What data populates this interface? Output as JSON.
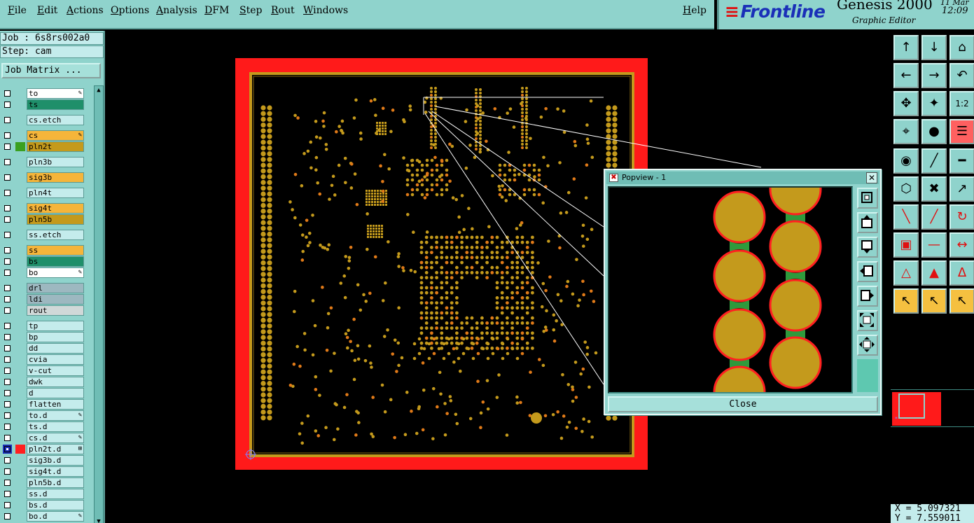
{
  "menubar": {
    "items": [
      "File",
      "Edit",
      "Actions",
      "Options",
      "Analysis",
      "DFM",
      "Step",
      "Rout",
      "Windows"
    ],
    "help": "Help"
  },
  "brand": {
    "logo": "Frontline",
    "product": "Genesis 2000",
    "subtitle": "Graphic Editor",
    "date": "11 Mar",
    "time": "12:09"
  },
  "left": {
    "job": "Job : 6s8rs002a0",
    "step": "Step: cam",
    "matrix_button": "Job Matrix ...",
    "layers": [
      {
        "name": "to",
        "bg": "#ffffff",
        "mark": "✎",
        "active": false,
        "swatch": ""
      },
      {
        "name": "ts",
        "bg": "#1f8f6a",
        "mark": "",
        "active": false,
        "swatch": ""
      },
      {
        "name": "cs.etch",
        "bg": "#c4ecec",
        "mark": "",
        "active": false,
        "swatch": ""
      },
      {
        "name": "cs",
        "bg": "#f5b53a",
        "mark": "✎",
        "active": false,
        "swatch": ""
      },
      {
        "name": "pln2t",
        "bg": "#c49a1c",
        "mark": "",
        "active": false,
        "swatch": "#3aa020"
      },
      {
        "name": "pln3b",
        "bg": "#c4ecec",
        "mark": "",
        "active": false,
        "swatch": ""
      },
      {
        "name": "sig3b",
        "bg": "#f5b53a",
        "mark": "",
        "active": false,
        "swatch": ""
      },
      {
        "name": "pln4t",
        "bg": "#c4ecec",
        "mark": "",
        "active": false,
        "swatch": ""
      },
      {
        "name": "sig4t",
        "bg": "#f5b53a",
        "mark": "",
        "active": false,
        "swatch": ""
      },
      {
        "name": "pln5b",
        "bg": "#c49a1c",
        "mark": "",
        "active": false,
        "swatch": ""
      },
      {
        "name": "ss.etch",
        "bg": "#c4ecec",
        "mark": "",
        "active": false,
        "swatch": ""
      },
      {
        "name": "ss",
        "bg": "#f5b53a",
        "mark": "",
        "active": false,
        "swatch": ""
      },
      {
        "name": "bs",
        "bg": "#1f8f6a",
        "mark": "",
        "active": false,
        "swatch": ""
      },
      {
        "name": "bo",
        "bg": "#ffffff",
        "mark": "✎",
        "active": false,
        "swatch": ""
      },
      {
        "name": "drl",
        "bg": "#9db8c0",
        "mark": "",
        "active": false,
        "swatch": ""
      },
      {
        "name": "ldi",
        "bg": "#9db8c0",
        "mark": "",
        "active": false,
        "swatch": ""
      },
      {
        "name": "rout",
        "bg": "#d0d8d8",
        "mark": "",
        "active": false,
        "swatch": ""
      },
      {
        "name": "tp",
        "bg": "#c4ecec",
        "mark": "",
        "active": false,
        "swatch": ""
      },
      {
        "name": "bp",
        "bg": "#c4ecec",
        "mark": "",
        "active": false,
        "swatch": ""
      },
      {
        "name": "dd",
        "bg": "#c4ecec",
        "mark": "",
        "active": false,
        "swatch": ""
      },
      {
        "name": "cvia",
        "bg": "#c4ecec",
        "mark": "",
        "active": false,
        "swatch": ""
      },
      {
        "name": "v-cut",
        "bg": "#c4ecec",
        "mark": "",
        "active": false,
        "swatch": ""
      },
      {
        "name": "dwk",
        "bg": "#c4ecec",
        "mark": "",
        "active": false,
        "swatch": ""
      },
      {
        "name": "d",
        "bg": "#c4ecec",
        "mark": "",
        "active": false,
        "swatch": ""
      },
      {
        "name": "flatten",
        "bg": "#c4ecec",
        "mark": "",
        "active": false,
        "swatch": ""
      },
      {
        "name": "to.d",
        "bg": "#c4ecec",
        "mark": "✎",
        "active": false,
        "swatch": ""
      },
      {
        "name": "ts.d",
        "bg": "#c4ecec",
        "mark": "",
        "active": false,
        "swatch": ""
      },
      {
        "name": "cs.d",
        "bg": "#c4ecec",
        "mark": "✎",
        "active": false,
        "swatch": ""
      },
      {
        "name": "pln2t.d",
        "bg": "#c4ecec",
        "mark": "⊞",
        "active": true,
        "swatch": "#ff2020"
      },
      {
        "name": "sig3b.d",
        "bg": "#c4ecec",
        "mark": "",
        "active": false,
        "swatch": ""
      },
      {
        "name": "sig4t.d",
        "bg": "#c4ecec",
        "mark": "",
        "active": false,
        "swatch": ""
      },
      {
        "name": "pln5b.d",
        "bg": "#c4ecec",
        "mark": "",
        "active": false,
        "swatch": ""
      },
      {
        "name": "ss.d",
        "bg": "#c4ecec",
        "mark": "",
        "active": false,
        "swatch": ""
      },
      {
        "name": "bs.d",
        "bg": "#c4ecec",
        "mark": "",
        "active": false,
        "swatch": ""
      },
      {
        "name": "bo.d",
        "bg": "#c4ecec",
        "mark": "✎",
        "active": false,
        "swatch": ""
      }
    ]
  },
  "popview": {
    "title": "Popview - 1",
    "close_label": "Close"
  },
  "status": {
    "x": "X = 5.097321",
    "y": "Y = 7.559011"
  },
  "colors": {
    "panel": "#8fd3cc",
    "board_frame": "#ff1a1a",
    "pad": "#c49a1c",
    "pad_orange": "#e07a18"
  }
}
